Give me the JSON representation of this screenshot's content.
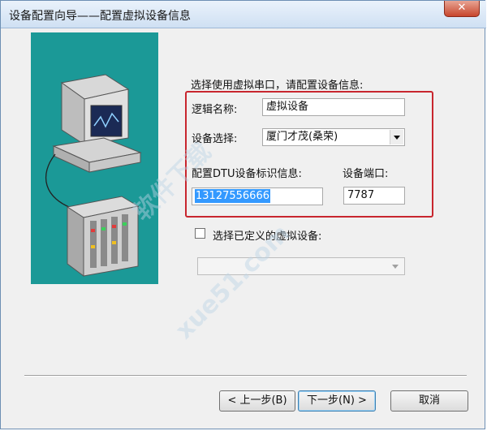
{
  "window": {
    "title": "设备配置向导——配置虚拟设备信息",
    "close_glyph": "✕"
  },
  "form": {
    "intro": "选择使用虚拟串口，请配置设备信息:",
    "logic_name_label": "逻辑名称:",
    "logic_name_value": "虚拟设备",
    "device_select_label": "设备选择:",
    "device_select_value": "厦门才茂(桑荣)",
    "dtu_label": "配置DTU设备标识信息:",
    "dtu_value": "13127556666",
    "port_label": "设备端口:",
    "port_value": "7787",
    "defined_device_label": "选择已定义的虚拟设备:"
  },
  "buttons": {
    "back": "< 上一步(B)",
    "next": "下一步(N) >",
    "cancel": "取消"
  },
  "watermark": {
    "text1": "软件下载",
    "text2": "xue51.com"
  },
  "colors": {
    "illustration_bg": "#1b9997",
    "highlight_border": "#c8262e",
    "selection_bg": "#3399ff"
  },
  "icons": {
    "illustration": "computer-and-device-illustration",
    "dropdown": "chevron-down-icon",
    "close": "close-icon"
  }
}
